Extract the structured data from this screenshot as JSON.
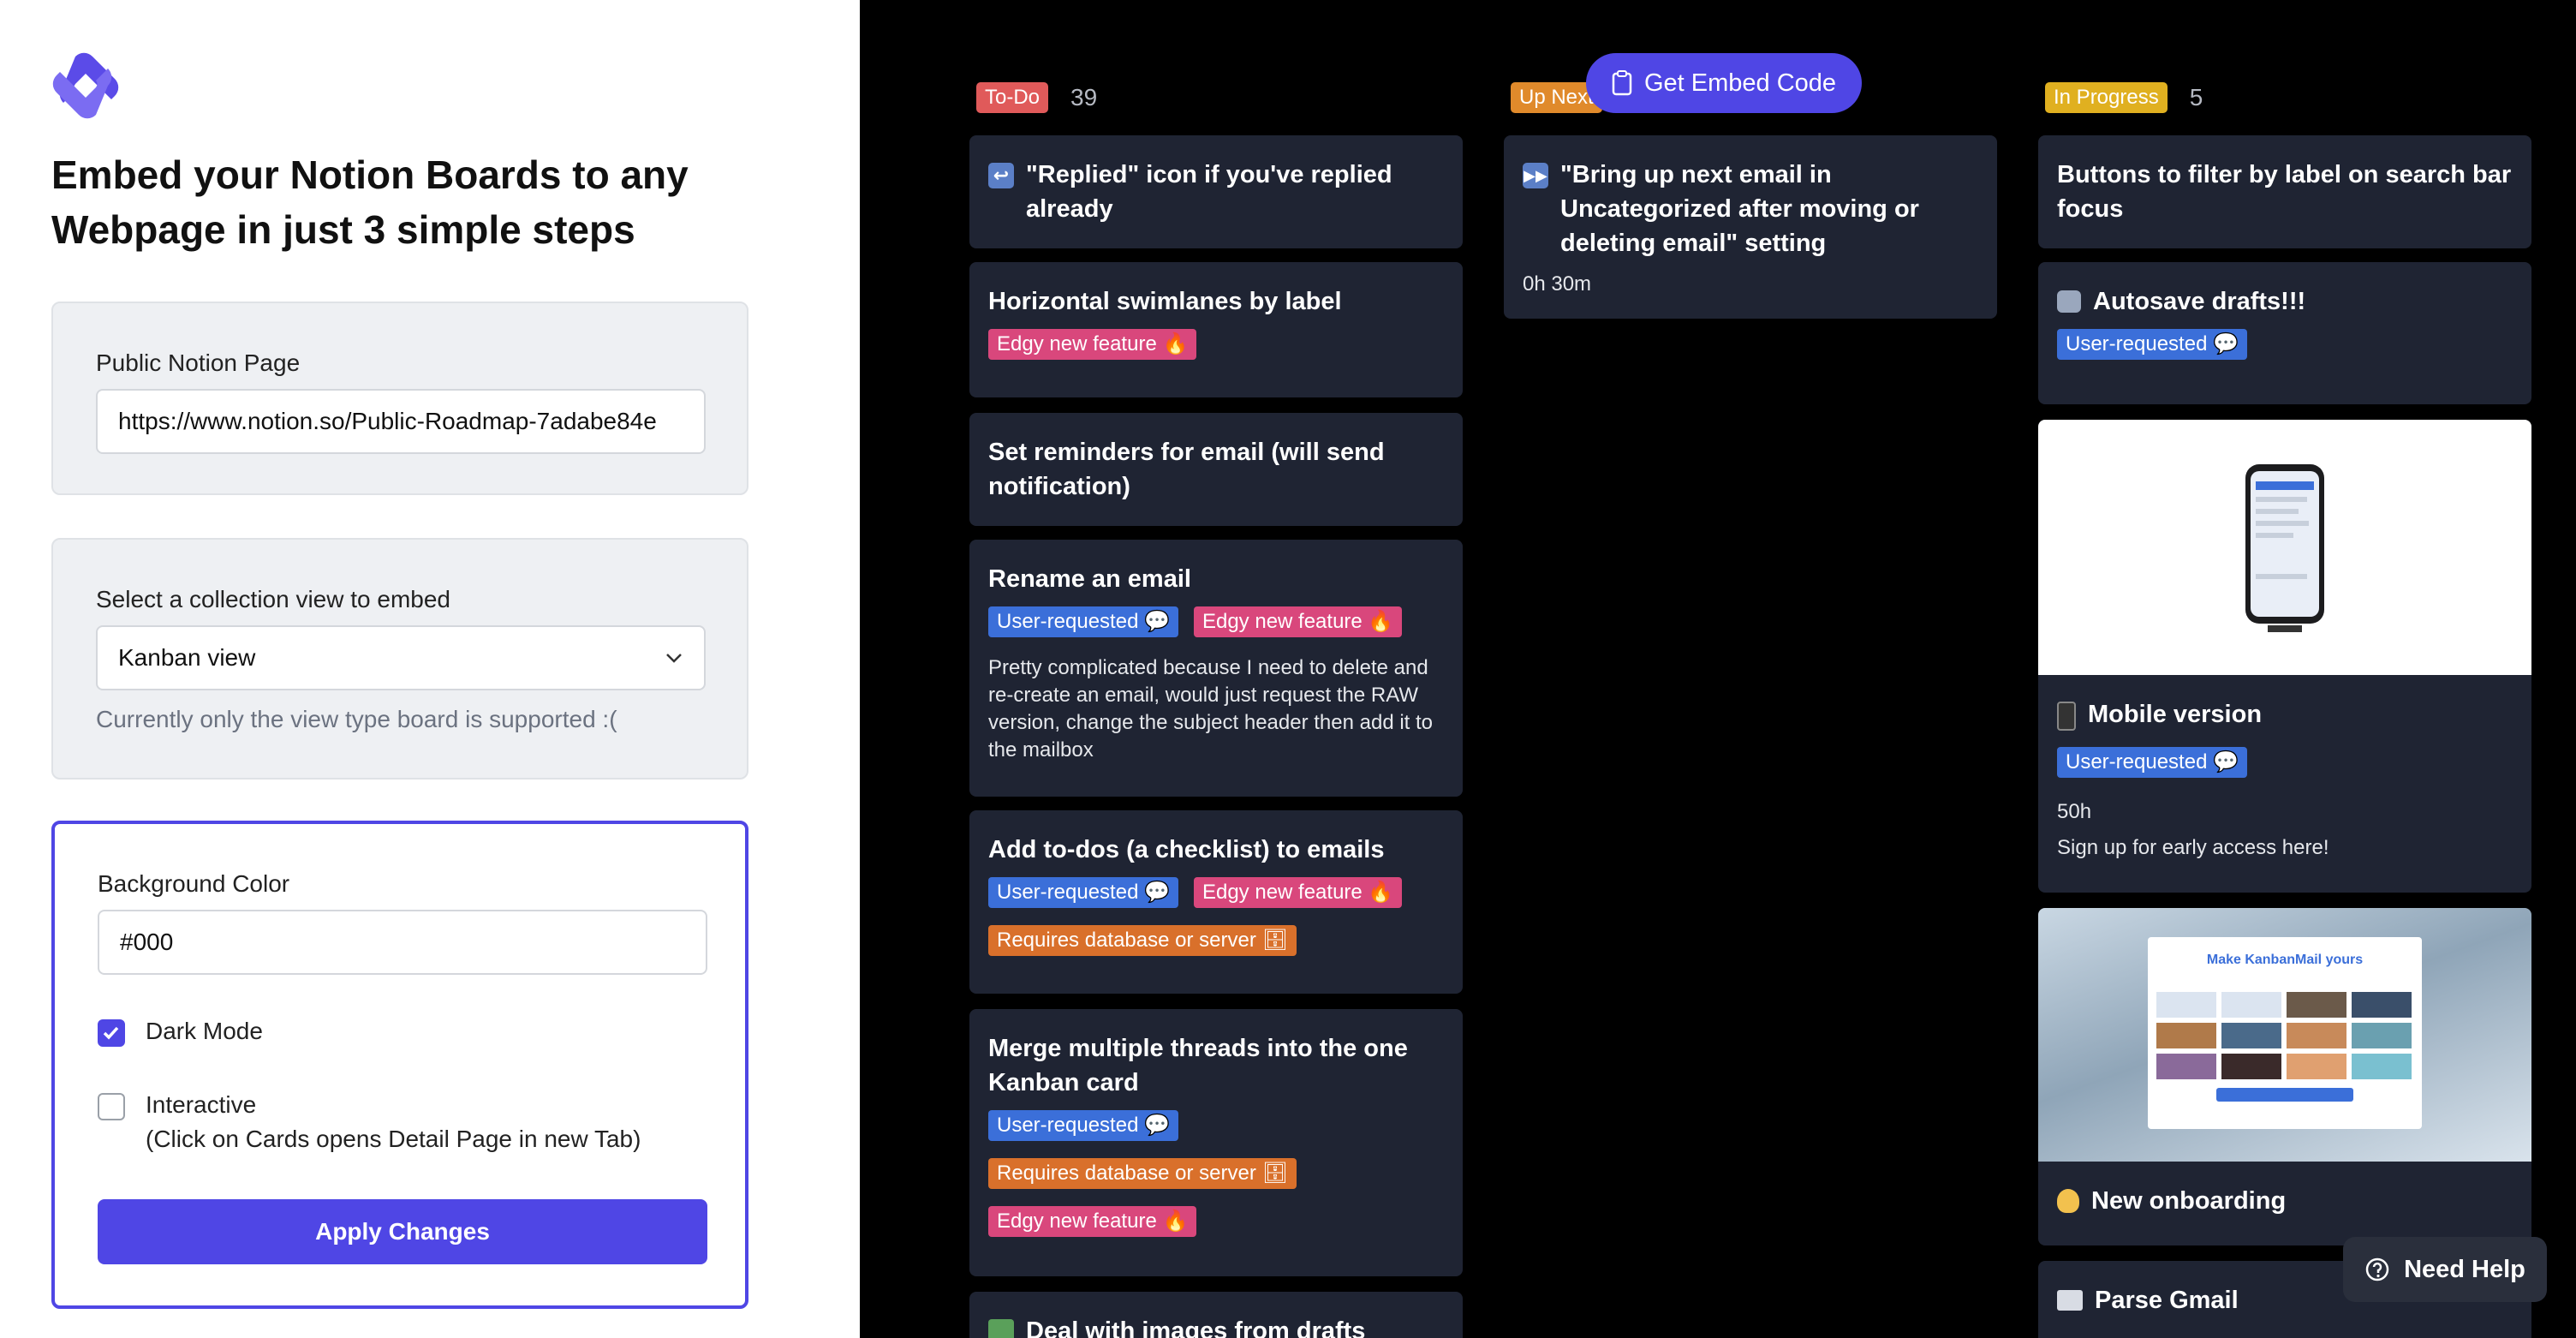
{
  "brand": {
    "accent": "#4f46e5"
  },
  "left": {
    "headline_line1": "Embed your Notion Boards to any",
    "headline_line2": "Webpage in just 3 simple steps",
    "page_card": {
      "label": "Public Notion Page",
      "value": "https://www.notion.so/Public-Roadmap-7adabe84e"
    },
    "view_card": {
      "label": "Select a collection view to embed",
      "selected": "Kanban view",
      "hint": "Currently only the view type board is supported :("
    },
    "style_card": {
      "bg_label": "Background Color",
      "bg_value": "#000",
      "dark_mode_label": "Dark Mode",
      "dark_mode_checked": true,
      "interactive_label": "Interactive",
      "interactive_sub": "(Click on Cards opens Detail Page in new Tab)",
      "interactive_checked": false,
      "apply_label": "Apply Changes"
    }
  },
  "board": {
    "embed_button": "Get Embed Code",
    "help_button": "Need Help",
    "columns": [
      {
        "status": "To-Do",
        "count": "39",
        "color": "#e05a5a"
      },
      {
        "status": "Up Next",
        "count": "",
        "color": "#e08a2b"
      },
      {
        "status": "In Progress",
        "count": "5",
        "color": "#e0b020"
      }
    ],
    "todo_cards": [
      {
        "emoji": "↩",
        "title": "\"Replied\" icon if you've replied already"
      },
      {
        "title": "Horizontal swimlanes by label",
        "tags": [
          "Edgy new feature 🔥"
        ]
      },
      {
        "title": "Set reminders for email (will send notification)"
      },
      {
        "title": "Rename an email",
        "tags": [
          "User-requested 💬",
          "Edgy new feature 🔥"
        ],
        "desc": "Pretty complicated because I need to delete and re-create an email, would just request the RAW version, change the subject header then add it to the mailbox"
      },
      {
        "title": "Add to-dos (a checklist) to emails",
        "tags": [
          "User-requested 💬",
          "Edgy new feature 🔥",
          "Requires database or server 🗄"
        ]
      },
      {
        "title": "Merge multiple threads into the one Kanban card",
        "tags": [
          "User-requested 💬",
          "Requires database or server 🗄",
          "Edgy new feature 🔥"
        ]
      },
      {
        "emoji": "🖼",
        "title": "Deal with images from drafts"
      }
    ],
    "upnext_cards": [
      {
        "emoji": "⏭",
        "title": "\"Bring up next email in Uncategorized after moving or deleting email\" setting",
        "meta": "0h 30m"
      }
    ],
    "progress_cards": [
      {
        "title": "Buttons to filter by label on search bar focus"
      },
      {
        "emoji": "🤖",
        "title": "Autosave drafts!!!",
        "tags": [
          "User-requested 💬"
        ]
      },
      {
        "emoji": "📱",
        "title": "Mobile version",
        "tags": [
          "User-requested 💬"
        ],
        "meta1": "50h",
        "meta2": "Sign up for early access here!"
      },
      {
        "emoji": "👋",
        "title": "New onboarding",
        "image_heading": "Make KanbanMail yours"
      },
      {
        "emoji": "📇",
        "title": "Parse Gmail"
      }
    ]
  }
}
